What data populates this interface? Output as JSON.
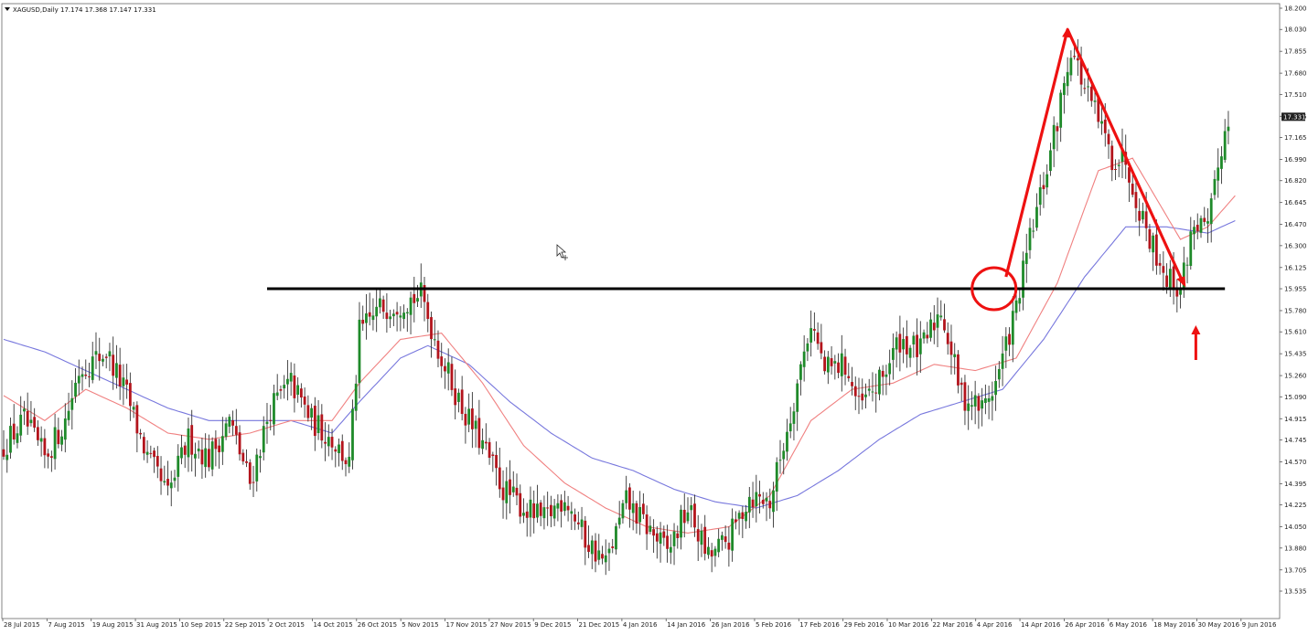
{
  "header": {
    "symbol_line": "XAGUSD,Daily  17.174 17.368 17.147 17.331",
    "triangle_icon": "triangle-down-icon"
  },
  "colors": {
    "background": "#ffffff",
    "bull": "#1f8a2a",
    "bear": "#b3141c",
    "wick": "#333333",
    "ma_fast": "#f08080",
    "ma_slow": "#7777dd",
    "support_line": "#000000",
    "annotation": "#ee1111",
    "price_box_bg": "#222222",
    "axis": "#555555"
  },
  "chart_data": {
    "type": "candlestick",
    "symbol": "XAGUSD",
    "timeframe": "Daily",
    "current_price_label": "17.331",
    "ylim": [
      13.535,
      18.2
    ],
    "y_tick_labels": [
      "18.200",
      "18.030",
      "17.855",
      "17.680",
      "17.510",
      "17.335",
      "17.165",
      "16.990",
      "16.820",
      "16.645",
      "16.470",
      "16.300",
      "16.125",
      "15.955",
      "15.780",
      "15.610",
      "15.435",
      "15.260",
      "15.090",
      "14.915",
      "14.745",
      "14.570",
      "14.395",
      "14.225",
      "14.050",
      "13.880",
      "13.705",
      "13.535"
    ],
    "x_tick_labels": [
      "28 Jul 2015",
      "7 Aug 2015",
      "19 Aug 2015",
      "31 Aug 2015",
      "10 Sep 2015",
      "22 Sep 2015",
      "2 Oct 2015",
      "14 Oct 2015",
      "26 Oct 2015",
      "5 Nov 2015",
      "17 Nov 2015",
      "27 Nov 2015",
      "9 Dec 2015",
      "21 Dec 2015",
      "4 Jan 2016",
      "14 Jan 2016",
      "26 Jan 2016",
      "5 Feb 2016",
      "17 Feb 2016",
      "29 Feb 2016",
      "10 Mar 2016",
      "22 Mar 2016",
      "4 Apr 2016",
      "14 Apr 2016",
      "26 Apr 2016",
      "6 May 2016",
      "18 May 2016",
      "30 May 2016",
      "9 Jun 2016"
    ],
    "close_anchors": [
      [
        0,
        14.7
      ],
      [
        6,
        14.9
      ],
      [
        12,
        14.6
      ],
      [
        18,
        14.9
      ],
      [
        22,
        15.3
      ],
      [
        30,
        15.45
      ],
      [
        36,
        15.1
      ],
      [
        42,
        14.6
      ],
      [
        48,
        14.3
      ],
      [
        54,
        14.75
      ],
      [
        60,
        14.6
      ],
      [
        66,
        14.9
      ],
      [
        72,
        14.4
      ],
      [
        78,
        15.0
      ],
      [
        84,
        15.2
      ],
      [
        90,
        14.9
      ],
      [
        96,
        14.75
      ],
      [
        101,
        14.55
      ],
      [
        104,
        15.6
      ],
      [
        110,
        15.8
      ],
      [
        116,
        15.85
      ],
      [
        122,
        15.9
      ],
      [
        128,
        15.4
      ],
      [
        134,
        15.0
      ],
      [
        140,
        14.7
      ],
      [
        146,
        14.35
      ],
      [
        152,
        14.2
      ],
      [
        158,
        14.1
      ],
      [
        164,
        14.3
      ],
      [
        170,
        13.95
      ],
      [
        176,
        13.75
      ],
      [
        182,
        14.25
      ],
      [
        188,
        14.05
      ],
      [
        194,
        13.85
      ],
      [
        200,
        14.2
      ],
      [
        206,
        13.8
      ],
      [
        212,
        13.95
      ],
      [
        218,
        14.3
      ],
      [
        224,
        14.25
      ],
      [
        230,
        14.95
      ],
      [
        236,
        15.7
      ],
      [
        240,
        15.3
      ],
      [
        246,
        15.35
      ],
      [
        250,
        15.0
      ],
      [
        256,
        15.2
      ],
      [
        262,
        15.55
      ],
      [
        268,
        15.45
      ],
      [
        274,
        15.8
      ],
      [
        280,
        15.1
      ],
      [
        286,
        15.0
      ],
      [
        290,
        15.2
      ],
      [
        296,
        15.8
      ],
      [
        300,
        16.35
      ],
      [
        304,
        16.8
      ],
      [
        308,
        17.3
      ],
      [
        312,
        17.9
      ],
      [
        316,
        17.55
      ],
      [
        320,
        17.3
      ],
      [
        324,
        17.0
      ],
      [
        328,
        17.0
      ],
      [
        332,
        16.6
      ],
      [
        336,
        16.3
      ],
      [
        340,
        16.05
      ],
      [
        344,
        15.95
      ],
      [
        348,
        16.5
      ],
      [
        352,
        16.4
      ],
      [
        356,
        17.1
      ],
      [
        358,
        17.3
      ]
    ],
    "ma_fast_anchors": [
      [
        0,
        15.1
      ],
      [
        12,
        14.9
      ],
      [
        24,
        15.15
      ],
      [
        36,
        15.0
      ],
      [
        48,
        14.8
      ],
      [
        60,
        14.75
      ],
      [
        72,
        14.8
      ],
      [
        84,
        14.9
      ],
      [
        96,
        14.9
      ],
      [
        104,
        15.2
      ],
      [
        116,
        15.55
      ],
      [
        128,
        15.6
      ],
      [
        140,
        15.2
      ],
      [
        152,
        14.7
      ],
      [
        164,
        14.4
      ],
      [
        176,
        14.2
      ],
      [
        188,
        14.05
      ],
      [
        200,
        14.0
      ],
      [
        212,
        14.05
      ],
      [
        224,
        14.3
      ],
      [
        236,
        14.9
      ],
      [
        248,
        15.15
      ],
      [
        260,
        15.2
      ],
      [
        272,
        15.35
      ],
      [
        284,
        15.3
      ],
      [
        296,
        15.4
      ],
      [
        308,
        16.0
      ],
      [
        320,
        16.9
      ],
      [
        330,
        17.0
      ],
      [
        344,
        16.35
      ],
      [
        352,
        16.45
      ],
      [
        360,
        16.7
      ]
    ],
    "ma_slow_anchors": [
      [
        0,
        15.55
      ],
      [
        12,
        15.45
      ],
      [
        24,
        15.3
      ],
      [
        36,
        15.15
      ],
      [
        48,
        15.0
      ],
      [
        60,
        14.9
      ],
      [
        72,
        14.9
      ],
      [
        84,
        14.9
      ],
      [
        96,
        14.8
      ],
      [
        104,
        15.05
      ],
      [
        116,
        15.4
      ],
      [
        124,
        15.5
      ],
      [
        136,
        15.35
      ],
      [
        148,
        15.05
      ],
      [
        160,
        14.8
      ],
      [
        172,
        14.6
      ],
      [
        184,
        14.5
      ],
      [
        196,
        14.35
      ],
      [
        208,
        14.25
      ],
      [
        220,
        14.2
      ],
      [
        232,
        14.3
      ],
      [
        244,
        14.5
      ],
      [
        256,
        14.75
      ],
      [
        268,
        14.95
      ],
      [
        280,
        15.05
      ],
      [
        292,
        15.15
      ],
      [
        304,
        15.55
      ],
      [
        316,
        16.05
      ],
      [
        328,
        16.45
      ],
      [
        340,
        16.45
      ],
      [
        352,
        16.4
      ],
      [
        360,
        16.5
      ]
    ],
    "annotations": {
      "support_level": 15.955,
      "circle_icon": "circle-annotation-icon",
      "up_arrow_icon": "up-arrow-annotation-icon",
      "peak_arrow_icon": "peak-arrow-annotation-icon"
    }
  }
}
